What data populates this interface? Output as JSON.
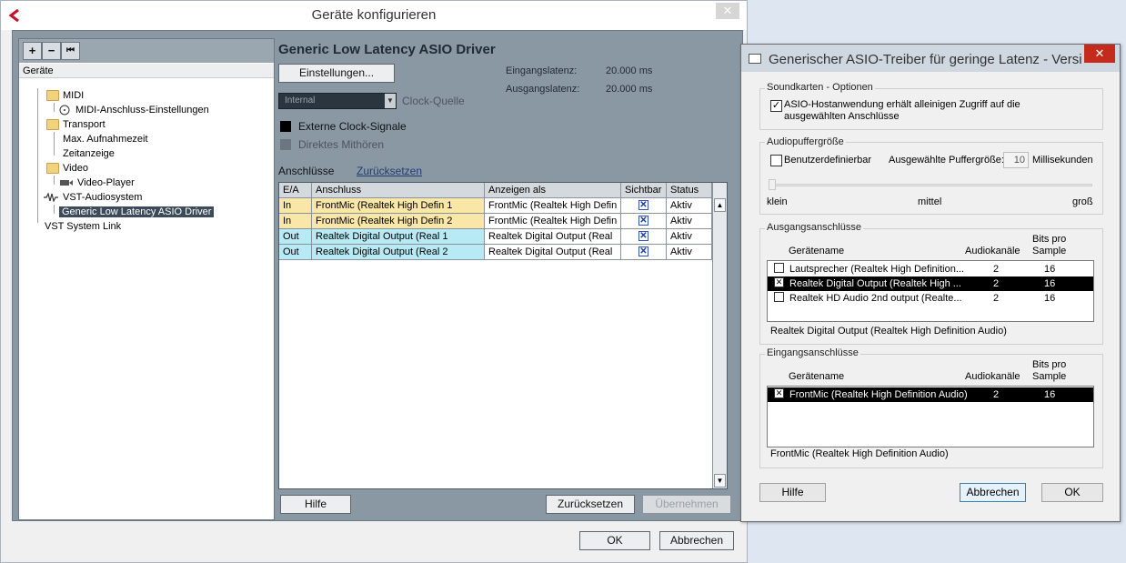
{
  "main": {
    "title": "Geräte konfigurieren",
    "close": "✕",
    "tree": {
      "toolbar": [
        "+",
        "−",
        "⏮"
      ],
      "header": "Geräte",
      "nodes": {
        "midi": "MIDI",
        "midi_port": "MIDI-Anschluss-Einstellungen",
        "transport": "Transport",
        "max_rec": "Max. Aufnahmezeit",
        "timecode": "Zeitanzeige",
        "video": "Video",
        "video_player": "Video-Player",
        "vst_audio": "VST-Audiosystem",
        "asio_driver": "Generic Low Latency ASIO Driver",
        "vst_link": "VST System Link"
      }
    },
    "driver_title": "Generic Low Latency ASIO Driver",
    "settings_button": "Einstellungen...",
    "input_latency_label": "Eingangslatenz:",
    "input_latency": "20.000 ms",
    "output_latency_label": "Ausgangslatenz:",
    "output_latency": "20.000 ms",
    "clock_select": "Internal",
    "clock_label": "Clock-Quelle",
    "external_clock": "Externe Clock-Signale",
    "direct_monitoring": "Direktes Mithören",
    "ports_label": "Anschlüsse",
    "reset_link": "Zurücksetzen",
    "columns": [
      "E/A",
      "Anschluss",
      "Anzeigen als",
      "Sichtbar",
      "Status"
    ],
    "rows": [
      {
        "io": "In",
        "port": "FrontMic (Realtek High Defin 1",
        "show_as": "FrontMic (Realtek High Defin",
        "visible": "✕",
        "status": "Aktiv"
      },
      {
        "io": "In",
        "port": "FrontMic (Realtek High Defin 2",
        "show_as": "FrontMic (Realtek High Defin",
        "visible": "✕",
        "status": "Aktiv"
      },
      {
        "io": "Out",
        "port": "Realtek Digital Output (Real 1",
        "show_as": "Realtek Digital Output (Real",
        "visible": "✕",
        "status": "Aktiv"
      },
      {
        "io": "Out",
        "port": "Realtek Digital Output (Real 2",
        "show_as": "Realtek Digital Output (Real",
        "visible": "✕",
        "status": "Aktiv"
      }
    ],
    "help_button": "Hilfe",
    "reset_button": "Zurücksetzen",
    "apply_button": "Übernehmen",
    "ok_button": "OK",
    "cancel_button": "Abbrechen"
  },
  "asio": {
    "title": "Generischer ASIO-Treiber für geringe Latenz - Versi",
    "close": "✕",
    "soundcard_group": "Soundkarten - Optionen",
    "exclusive_check": "ASIO-Hostanwendung erhält alleinigen Zugriff auf die ausgewählten Anschlüsse",
    "buffer_group": "Audiopuffergröße",
    "custom_check": "Benutzerdefinierbar",
    "buffer_label": "Ausgewählte Puffergröße:",
    "buffer_value": "10",
    "buffer_unit": "Millisekunden",
    "slider_min": "klein",
    "slider_mid": "mittel",
    "slider_max": "groß",
    "slider_level": 0.0,
    "output_group": "Ausgangsanschlüsse",
    "col_device": "Gerätename",
    "col_channels": "Audiokanäle",
    "col_bits": "Bits pro Sample",
    "outputs": [
      {
        "checked": "",
        "name": "Lautsprecher (Realtek High Definition...",
        "channels": "2",
        "bits": "16"
      },
      {
        "checked": "✕",
        "name": "Realtek Digital Output (Realtek High ...",
        "channels": "2",
        "bits": "16"
      },
      {
        "checked": "",
        "name": "Realtek HD Audio 2nd output (Realte...",
        "channels": "2",
        "bits": "16"
      }
    ],
    "output_selected": "Realtek Digital Output (Realtek High Definition Audio)",
    "input_group": "Eingangsanschlüsse",
    "inputs": [
      {
        "checked": "✕",
        "name": "FrontMic (Realtek High Definition Audio)",
        "channels": "2",
        "bits": "16"
      }
    ],
    "input_selected": "FrontMic (Realtek High Definition Audio)",
    "help_button": "Hilfe",
    "cancel_button": "Abbrechen",
    "ok_button": "OK"
  },
  "colors": {
    "in_row": "#f9e7a8",
    "out_row": "#b7eaf4",
    "panel": "#8a98a4",
    "selection": "#3c4a5a",
    "close_red": "#c42b1c"
  }
}
